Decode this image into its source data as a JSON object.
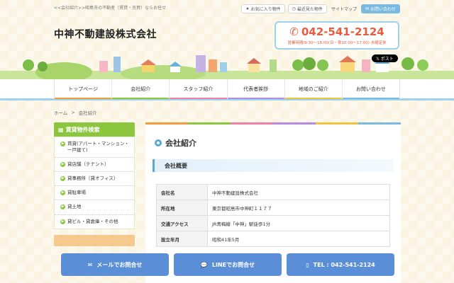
{
  "header": {
    "tagline": "<<会社紹介>>昭島市の不動産（賃貸・売買）ならお任せ",
    "company_name": "中神不動建設株式会社",
    "favorites_label": "お気に入り物件",
    "recent_label": "最近見た物件",
    "sitemap_label": "サイトマップ",
    "contact_label": "お問い合わせ",
    "phone": "042-541-2124",
    "hours": "営業時間/9:30～18:00(日・祭10:00～17:00) 水曜定休",
    "xpost_label": "ポスト"
  },
  "nav": {
    "items": [
      {
        "label": "トップページ"
      },
      {
        "label": "会社紹介"
      },
      {
        "label": "スタッフ紹介"
      },
      {
        "label": "代表者挨拶"
      },
      {
        "label": "地域のご紹介"
      },
      {
        "label": "お問い合わせ"
      }
    ]
  },
  "breadcrumb": {
    "home": "ホーム",
    "separator": ">",
    "current": "会社紹介"
  },
  "sidebar": {
    "title": "賃貸物件検索",
    "items": [
      {
        "label": "賃貸(アパート・マンション・一戸建て)"
      },
      {
        "label": "貸店舗（テナント）"
      },
      {
        "label": "貸事務所（貸オフィス）"
      },
      {
        "label": "貸駐車場"
      },
      {
        "label": "貸土地"
      },
      {
        "label": "貸ビル・貸倉庫・その他"
      }
    ]
  },
  "main": {
    "title": "会社紹介",
    "subheading": "会社概要",
    "table": [
      {
        "label": "会社名",
        "value": "中神不動建設株式会社"
      },
      {
        "label": "所在地",
        "value": "東京都昭島市中神町１１７７"
      },
      {
        "label": "交通アクセス",
        "value": "JR青梅線「中神」駅徒歩1分"
      },
      {
        "label": "設立年月",
        "value": "昭和41年5月"
      }
    ]
  },
  "footer": {
    "mail_label": "メールでお問合せ",
    "line_label": "LINEでお問合せ",
    "tel_label": "TEL : 042-541-2124"
  },
  "colors": {
    "accent_blue": "#5a8fd8",
    "accent_green": "#8cc63f",
    "phone_red": "#e95b3d",
    "light_blue": "#9dd2ec"
  }
}
